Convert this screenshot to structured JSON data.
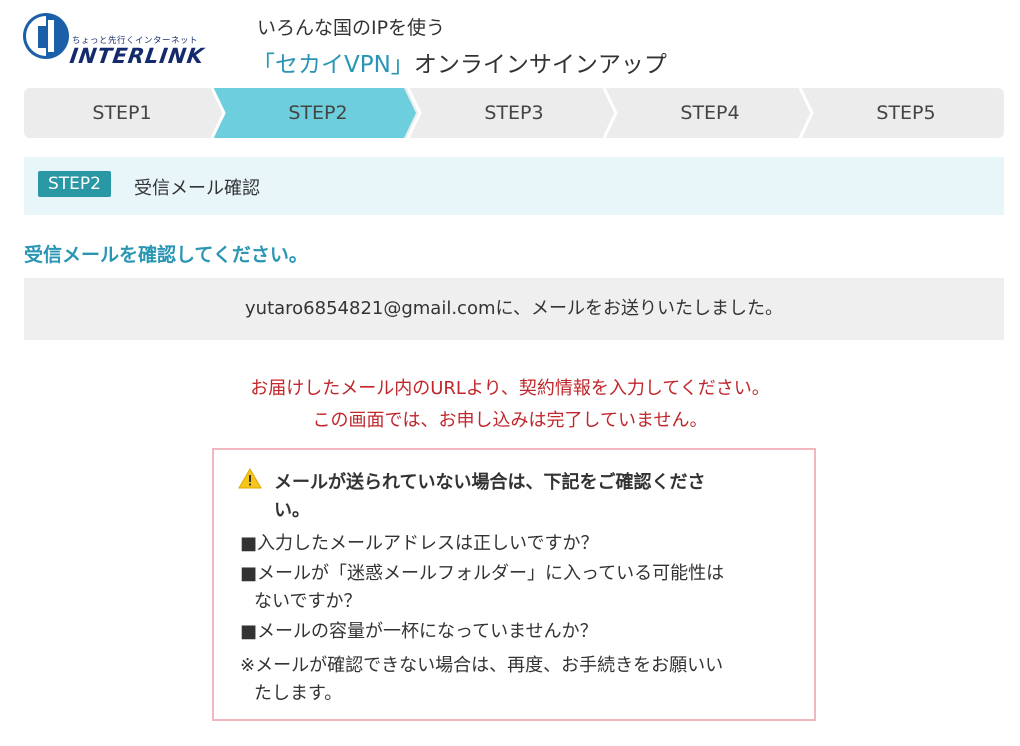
{
  "header": {
    "logo_tagline": "ちょっと先行くインターネット",
    "logo_text": "INTERLINK",
    "subtitle": "いろんな国のIPを使う",
    "title_accent": "「セカイVPN」",
    "title_rest": "オンラインサインアップ"
  },
  "steps": [
    {
      "label": "STEP1",
      "active": false
    },
    {
      "label": "STEP2",
      "active": true
    },
    {
      "label": "STEP3",
      "active": false
    },
    {
      "label": "STEP4",
      "active": false
    },
    {
      "label": "STEP5",
      "active": false
    }
  ],
  "current_step": {
    "badge": "STEP2",
    "title": "受信メール確認"
  },
  "confirm_title": "受信メールを確認してください。",
  "sent_message": "yutaro6854821@gmail.comに、メールをお送りいたしました。",
  "notice": {
    "line1": "お届けしたメール内のURLより、契約情報を入力してください。",
    "line2": "この画面では、お申し込みは完了していません。"
  },
  "help": {
    "heading_line1": "メールが送られていない場合は、下記をご確認くださ",
    "heading_line2": "い。",
    "item1": "■入力したメールアドレスは正しいですか？",
    "item2_line1": "■メールが「迷惑メールフォルダー」に入っている可能性は",
    "item2_line2": "ないですか？",
    "item3": "■メールの容量が一杯になっていませんか？",
    "note_line1": "※メールが確認できない場合は、再度、お手続きをお願いい",
    "note_line2": "たします。"
  },
  "colors": {
    "accent": "#2a96b4",
    "step_active": "#6dcfdd",
    "step_inactive": "#ececec",
    "notice_red": "#c0262b",
    "help_border": "#f0b7bf",
    "badge": "#2a97a5"
  },
  "icons": {
    "logo": "interlink-logo-icon",
    "warning": "warning-triangle-icon"
  }
}
